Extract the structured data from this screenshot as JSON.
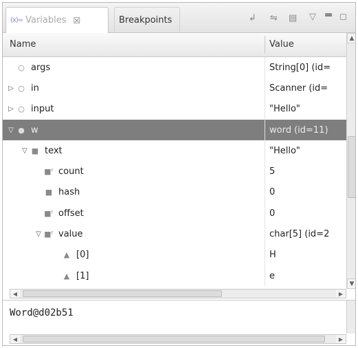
{
  "tabs": {
    "variables": {
      "label": "Variables",
      "icon": "variables-icon",
      "close": "☒"
    },
    "breakpoints": {
      "label": "Breakpoints"
    }
  },
  "toolbar": [
    "collapse-all-icon",
    "show-type-names-icon",
    "layout-icon",
    "view-menu-icon",
    "minimize-icon",
    "maximize-icon"
  ],
  "columns": {
    "name": "Name",
    "value": "Value"
  },
  "rows": [
    {
      "name": "args",
      "value": "String[0]  (id=",
      "expander": "",
      "icon": "○",
      "indent": 0,
      "selected": false
    },
    {
      "name": "in",
      "value": "Scanner  (id=",
      "expander": "▷",
      "icon": "○",
      "indent": 0,
      "selected": false
    },
    {
      "name": "input",
      "value": "\"Hello\"",
      "expander": "▷",
      "icon": "○",
      "indent": 0,
      "selected": false
    },
    {
      "name": "w",
      "value": "word  (id=11)",
      "expander": "▽",
      "icon": "●",
      "indent": 0,
      "selected": true
    },
    {
      "name": "text",
      "value": "\"Hello\"",
      "expander": "▽",
      "icon": "■",
      "indent": 1,
      "selected": false
    },
    {
      "name": "count",
      "value": "5",
      "expander": "",
      "icon": "■ᶠ",
      "indent": 2,
      "selected": false
    },
    {
      "name": "hash",
      "value": "0",
      "expander": "",
      "icon": "■",
      "indent": 2,
      "selected": false
    },
    {
      "name": "offset",
      "value": "0",
      "expander": "",
      "icon": "■ᶠ",
      "indent": 2,
      "selected": false
    },
    {
      "name": "value",
      "value": "char[5]  (id=2",
      "expander": "▽",
      "icon": "■ᶠ",
      "indent": 2,
      "selected": false
    },
    {
      "name": "[0]",
      "value": "H",
      "expander": "",
      "icon": "▲",
      "indent": 3,
      "selected": false
    },
    {
      "name": "[1]",
      "value": "e",
      "expander": "",
      "icon": "▲",
      "indent": 3,
      "selected": false
    }
  ],
  "detail": {
    "text": "Word@d02b51"
  },
  "colors": {
    "selection": "#7e7e7e",
    "tab_active_text": "#a8a8a8"
  }
}
